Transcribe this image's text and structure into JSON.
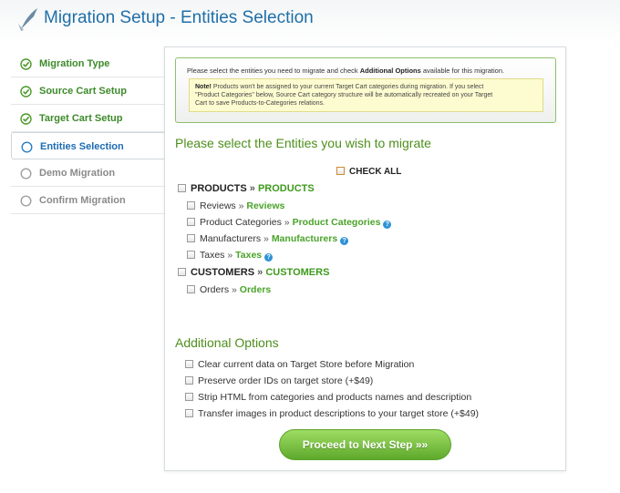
{
  "header": {
    "title": "Migration Setup - Entities Selection",
    "logo_icon": "arrow-logo-icon"
  },
  "sidebar": {
    "items": [
      {
        "label": "Migration Type",
        "state": "done"
      },
      {
        "label": "Source Cart Setup",
        "state": "done"
      },
      {
        "label": "Target Cart Setup",
        "state": "done"
      },
      {
        "label": "Entities Selection",
        "state": "active"
      },
      {
        "label": "Demo Migration",
        "state": "pending"
      },
      {
        "label": "Confirm Migration",
        "state": "pending"
      }
    ]
  },
  "notice": {
    "intro_before": "Please select the entities you need to migrate and check ",
    "intro_bold": "Additional Options",
    "intro_after": " available for this migration.",
    "note_label": "Note!",
    "note_line1": " Products won't be assigned to your current Target Cart categories during migration. If you select",
    "note_line2": "\"Product Categories\" below, Source Cart category structure will be automatically recreated on your Target",
    "note_line3": "Cart to save Products-to-Categories relations."
  },
  "entities": {
    "title": "Please select the Entities you wish to migrate",
    "check_all": "CHECK ALL",
    "separator": " » ",
    "groups": [
      {
        "source": "PRODUCTS",
        "target": "PRODUCTS",
        "children": [
          {
            "source": "Reviews",
            "target": "Reviews",
            "help": false
          },
          {
            "source": "Product Categories",
            "target": "Product Categories",
            "help": true
          },
          {
            "source": "Manufacturers",
            "target": "Manufacturers",
            "help": true
          },
          {
            "source": "Taxes",
            "target": "Taxes",
            "help": true
          }
        ]
      },
      {
        "source": "CUSTOMERS",
        "target": "CUSTOMERS",
        "children": [
          {
            "source": "Orders",
            "target": "Orders",
            "help": false
          }
        ]
      }
    ],
    "help_glyph": "?"
  },
  "additional": {
    "title": "Additional Options",
    "options": [
      "Clear current data on Target Store before Migration",
      "Preserve order IDs on target store (+$49)",
      "Strip HTML from categories and products names and description",
      "Transfer images in product descriptions to your target store (+$49)"
    ]
  },
  "proceed_label": "Proceed to Next Step »»",
  "colors": {
    "title_blue": "#1f6fa8",
    "done_green": "#3d8a2a",
    "active_blue": "#1d6bb3",
    "accent_green": "#4e8f1c",
    "button_green": "#6fb83a",
    "help_blue": "#2f93d6"
  }
}
